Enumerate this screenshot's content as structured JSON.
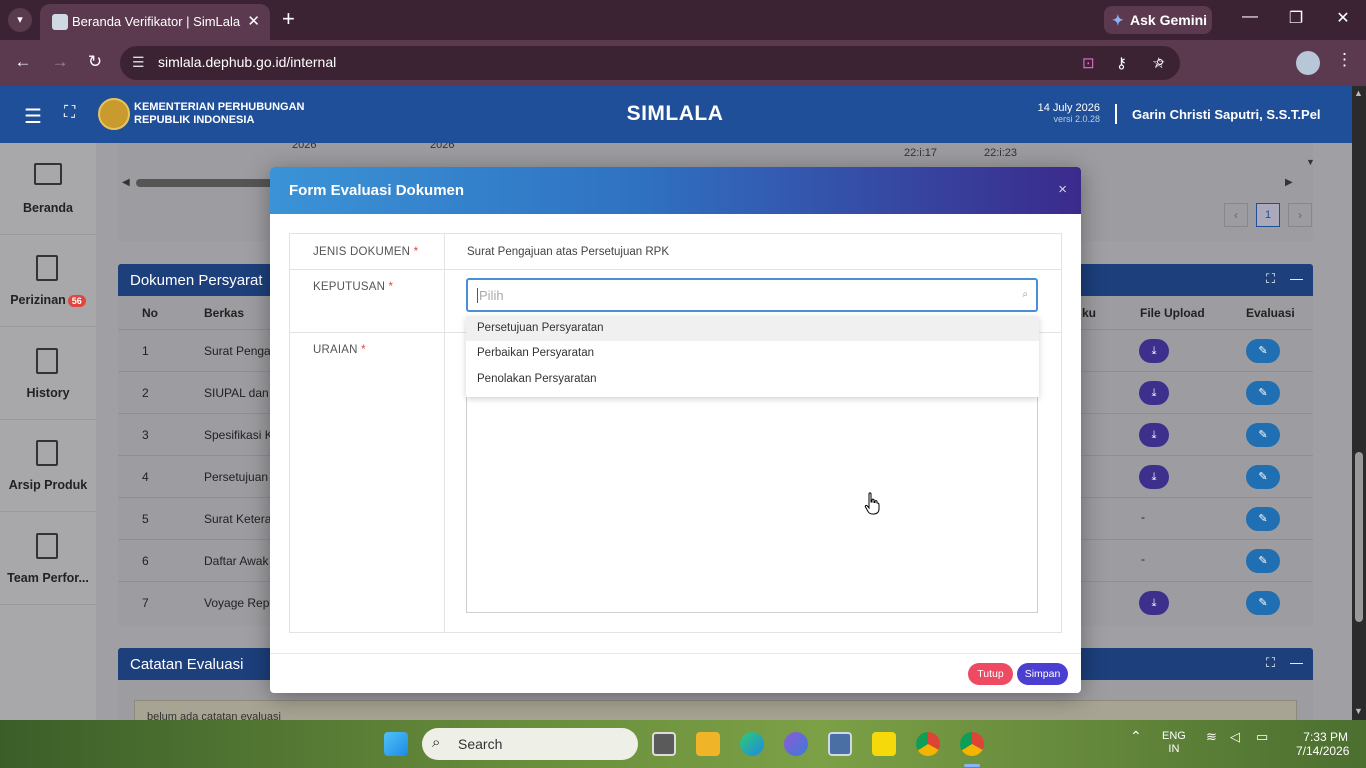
{
  "browser": {
    "tab_title": "Beranda Verifikator | SimLala",
    "url": "simlala.dephub.go.id/internal",
    "ask_gemini": "Ask Gemini"
  },
  "header": {
    "ministry_line1": "KEMENTERIAN PERHUBUNGAN",
    "ministry_line2": "REPUBLIK INDONESIA",
    "app_title": "SIMLALA",
    "date": "14 July 2026",
    "version": "versi 2.0.28",
    "user": "Garin Christi Saputri, S.S.T.Pel"
  },
  "sidebar": {
    "items": [
      {
        "label": "Beranda"
      },
      {
        "label": "Perizinan",
        "badge": "56"
      },
      {
        "label": "History"
      },
      {
        "label": "Arsip Produk"
      },
      {
        "label": "Team Perfor..."
      }
    ]
  },
  "top_table": {
    "year1": "2026",
    "year2": "2026",
    "time1": "22:i:17",
    "time2": "22:i:23",
    "page": "1"
  },
  "dokumen_card": {
    "title": "Dokumen Persyarat",
    "col_no": "No",
    "col_berkas": "Berkas",
    "col_waktu": "ku",
    "col_file": "File Upload",
    "col_eval": "Evaluasi",
    "rows": [
      {
        "no": "1",
        "berkas": "Surat Pengaju",
        "file": true
      },
      {
        "no": "2",
        "berkas": "SIUPAL dan B",
        "file": true
      },
      {
        "no": "3",
        "berkas": "Spesifikasi Ka",
        "file": true
      },
      {
        "no": "4",
        "berkas": "Persetujuan S",
        "file": true
      },
      {
        "no": "5",
        "berkas": "Surat Keteran",
        "file": false,
        "file_text": "-"
      },
      {
        "no": "6",
        "berkas": "Daftar Awak K",
        "file": false,
        "file_text": "-"
      },
      {
        "no": "7",
        "berkas": "Voyage Repo",
        "file": true
      }
    ]
  },
  "catatan_card": {
    "title": "Catatan Evaluasi",
    "empty_text": "belum ada catatan evaluasi"
  },
  "modal": {
    "title": "Form Evaluasi Dokumen",
    "close": "×",
    "jenis_label": "JENIS DOKUMEN",
    "jenis_value": "Surat Pengajuan atas Persetujuan RPK",
    "keputusan_label": "KEPUTUSAN",
    "uraian_label": "URAIAN",
    "required_mark": "*",
    "select_placeholder": "Pilih",
    "options": [
      "Persetujuan Persyaratan",
      "Perbaikan Persyaratan",
      "Penolakan Persyaratan"
    ],
    "btn_tutup": "Tutup",
    "btn_simpan": "Simpan"
  },
  "taskbar": {
    "search": "Search",
    "lang1": "ENG",
    "lang2": "IN",
    "time": "7:33 PM",
    "date": "7/14/2026"
  }
}
